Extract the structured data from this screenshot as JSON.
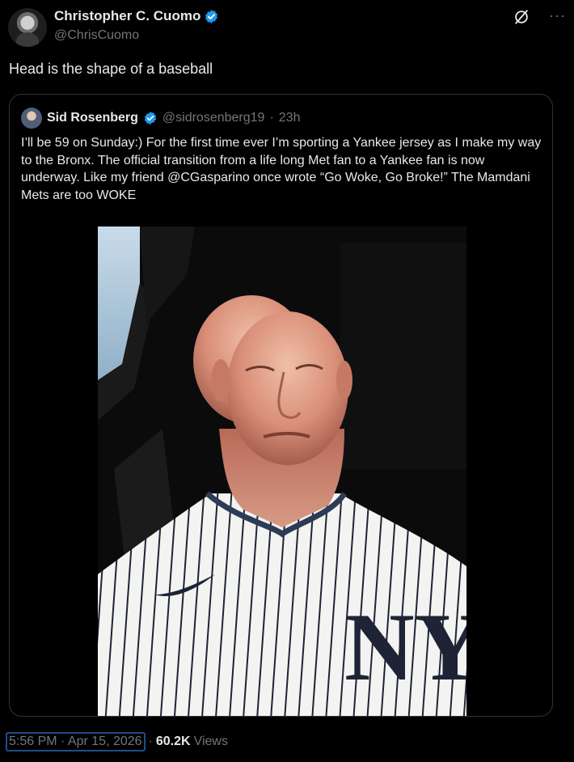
{
  "author": {
    "display_name": "Christopher C. Cuomo",
    "handle": "@ChrisCuomo"
  },
  "tweet": {
    "text": "Head is the shape of a baseball"
  },
  "quoted": {
    "display_name": "Sid Rosenberg",
    "handle": "@sidrosenberg19",
    "separator": "·",
    "age": "23h",
    "text": "I’ll be 59 on Sunday:) For the first time ever I’m sporting a Yankee jersey as I make my way to the Bronx. The official transition from a life long Met fan to a Yankee fan is now underway. Like my friend @CGasparino once wrote “Go Woke, Go Broke!” The Mamdani Mets are too WOKE"
  },
  "footer": {
    "timestamp": "5:56 PM · Apr 15, 2026",
    "separator": "·",
    "views_count": "60.2K",
    "views_label": "Views"
  },
  "icons": {
    "verified": "verified-badge-icon",
    "grok": "grok-icon",
    "more": "more-icon"
  },
  "colors": {
    "background": "#000000",
    "text": "#e7e9ea",
    "secondary": "#71767b",
    "verified": "#1d9bf0",
    "border": "#2f3336"
  }
}
